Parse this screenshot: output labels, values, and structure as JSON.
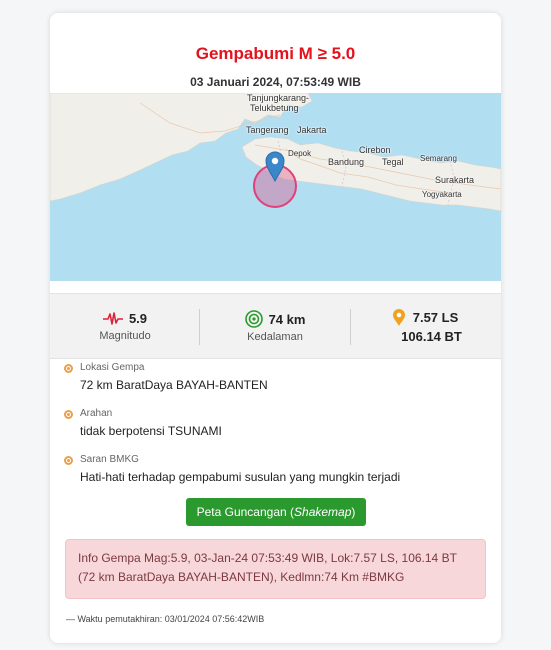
{
  "card": {
    "title": "Gempabumi M ≥ 5.0",
    "datetime": "03 Januari 2024, 07:53:49 WIB"
  },
  "map": {
    "labels": {
      "tanjungkarang": "Tanjungkarang-",
      "telukbetung": "Telukbetung",
      "tangerang": "Tangerang",
      "jakarta": "Jakarta",
      "depok": "Depok",
      "cirebon": "Cirebon",
      "bandung": "Bandung",
      "tegal": "Tegal",
      "semarang": "Semarang",
      "surakarta": "Surakarta",
      "yogyakarta": "Yogyakarta"
    },
    "colors": {
      "sea": "#b2def2",
      "land": "#f1efe9",
      "marker": "#3a87c9",
      "epicenter": "#e0417a"
    }
  },
  "stats": {
    "magnitude_value": "5.9",
    "magnitude_label": "Magnitudo",
    "depth_value": "74 km",
    "depth_label": "Kedalaman",
    "lat": "7.57 LS",
    "lon": "106.14 BT"
  },
  "info": {
    "location_key": "Lokasi Gempa",
    "location_value": "72 km BaratDaya BAYAH-BANTEN",
    "direction_key": "Arahan",
    "direction_value": "tidak berpotensi TSUNAMI",
    "advice_key": "Saran BMKG",
    "advice_value": "Hati-hati terhadap gempabumi susulan yang mungkin terjadi"
  },
  "shakemap_button": {
    "label": "Peta Guncangan (",
    "label_em": "Shakemap",
    "label_end": ")",
    "color": "#2b9a2e"
  },
  "alert": {
    "text": "Info Gempa Mag:5.9, 03-Jan-24 07:53:49 WIB, Lok:7.57 LS, 106.14 BT (72 km BaratDaya BAYAH-BANTEN), Kedlmn:74 Km #BMKG"
  },
  "updated": {
    "text": "Waktu pemutakhiran: 03/01/2024 07:56:42WIB"
  }
}
